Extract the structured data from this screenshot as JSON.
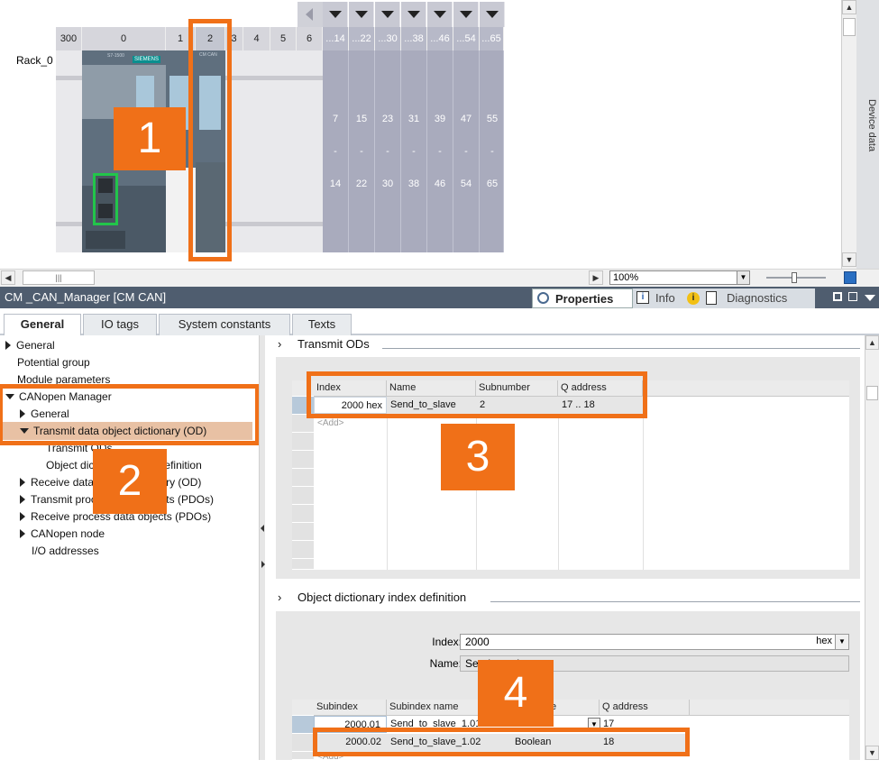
{
  "rack": {
    "rack_label": "Rack_0",
    "slot_numbers": [
      "300",
      "0",
      "1",
      "2",
      "3",
      "4",
      "5",
      "6"
    ],
    "range_headers": [
      "...14",
      "...22",
      "...30",
      "...38",
      "...46",
      "...54",
      "...65"
    ],
    "range_start": [
      "7",
      "15",
      "23",
      "31",
      "39",
      "47",
      "55"
    ],
    "range_dash": "-",
    "range_end": [
      "14",
      "22",
      "30",
      "38",
      "46",
      "54",
      "65"
    ],
    "cpu_brand": "SIEMENS",
    "cpu_tag": "S7-1500",
    "module_tag": "CM CAN",
    "zoom_value": "100%"
  },
  "annotations": [
    "1",
    "2",
    "3",
    "4"
  ],
  "inspector": {
    "title": "CM _CAN_Manager [CM CAN]",
    "side_tab": "Device data",
    "tabs_right": [
      "Properties",
      "Info",
      "Diagnostics"
    ],
    "tabs_left": [
      "General",
      "IO tags",
      "System constants",
      "Texts"
    ]
  },
  "tree": {
    "items": [
      {
        "label": "General",
        "expand": "right"
      },
      {
        "label": "Potential group",
        "expand": "none"
      },
      {
        "label": "Module parameters",
        "expand": "none"
      },
      {
        "label": "CANopen Manager",
        "expand": "down"
      },
      {
        "label": "General",
        "expand": "right"
      },
      {
        "label": "Transmit data object dictionary (OD)",
        "expand": "down"
      },
      {
        "label": "Transmit ODs",
        "expand": "none"
      },
      {
        "label": "Object dictionary index definition",
        "expand": "none"
      },
      {
        "label": "Receive data object dictionary (OD)",
        "expand": "right"
      },
      {
        "label": "Transmit process data objects (PDOs)",
        "expand": "right"
      },
      {
        "label": "Receive process data objects (PDOs)",
        "expand": "right"
      },
      {
        "label": "CANopen node",
        "expand": "right"
      },
      {
        "label": "I/O addresses",
        "expand": "none"
      }
    ]
  },
  "transmit_ods": {
    "section_title": "Transmit ODs",
    "columns": [
      "Index",
      "Name",
      "Subnumber",
      "Q address"
    ],
    "rows": [
      [
        "2000 hex",
        "Send_to_slave",
        "2",
        "17 .. 18"
      ]
    ],
    "add_row": "<Add>"
  },
  "od_definition": {
    "section_title": "Object dictionary index definition",
    "index_label": "Index:",
    "index_value": "2000",
    "index_unit": "hex",
    "name_label": "Name:",
    "name_value": "Send_to_slave",
    "columns": [
      "Subindex",
      "Subindex name",
      "Data type",
      "Q address"
    ],
    "rows": [
      [
        "2000.01",
        "Send_to_slave_1.01",
        "Boolean",
        "17"
      ],
      [
        "2000.02",
        "Send_to_slave_1.02",
        "Boolean",
        "18"
      ]
    ],
    "add_row": "<Add>"
  }
}
